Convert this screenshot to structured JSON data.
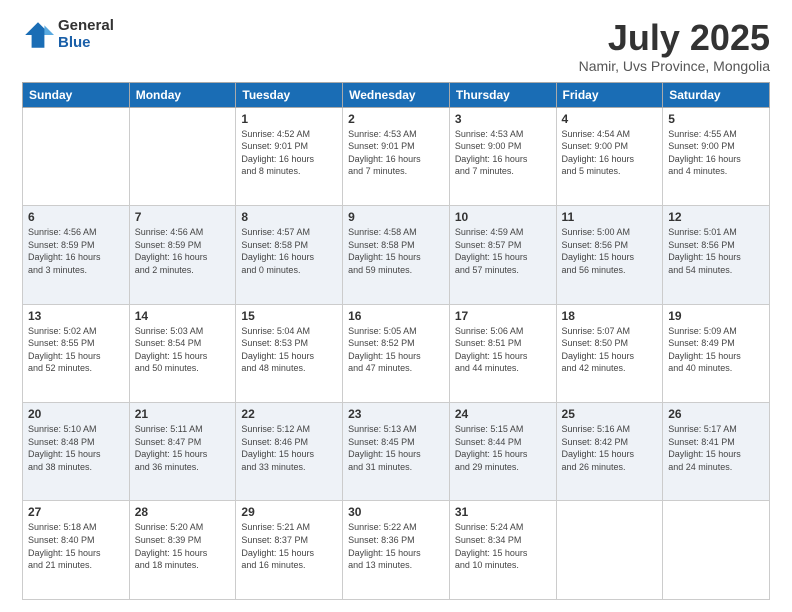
{
  "logo": {
    "general": "General",
    "blue": "Blue"
  },
  "title": "July 2025",
  "subtitle": "Namir, Uvs Province, Mongolia",
  "headers": [
    "Sunday",
    "Monday",
    "Tuesday",
    "Wednesday",
    "Thursday",
    "Friday",
    "Saturday"
  ],
  "weeks": [
    [
      {
        "day": "",
        "info": ""
      },
      {
        "day": "",
        "info": ""
      },
      {
        "day": "1",
        "info": "Sunrise: 4:52 AM\nSunset: 9:01 PM\nDaylight: 16 hours\nand 8 minutes."
      },
      {
        "day": "2",
        "info": "Sunrise: 4:53 AM\nSunset: 9:01 PM\nDaylight: 16 hours\nand 7 minutes."
      },
      {
        "day": "3",
        "info": "Sunrise: 4:53 AM\nSunset: 9:00 PM\nDaylight: 16 hours\nand 7 minutes."
      },
      {
        "day": "4",
        "info": "Sunrise: 4:54 AM\nSunset: 9:00 PM\nDaylight: 16 hours\nand 5 minutes."
      },
      {
        "day": "5",
        "info": "Sunrise: 4:55 AM\nSunset: 9:00 PM\nDaylight: 16 hours\nand 4 minutes."
      }
    ],
    [
      {
        "day": "6",
        "info": "Sunrise: 4:56 AM\nSunset: 8:59 PM\nDaylight: 16 hours\nand 3 minutes."
      },
      {
        "day": "7",
        "info": "Sunrise: 4:56 AM\nSunset: 8:59 PM\nDaylight: 16 hours\nand 2 minutes."
      },
      {
        "day": "8",
        "info": "Sunrise: 4:57 AM\nSunset: 8:58 PM\nDaylight: 16 hours\nand 0 minutes."
      },
      {
        "day": "9",
        "info": "Sunrise: 4:58 AM\nSunset: 8:58 PM\nDaylight: 15 hours\nand 59 minutes."
      },
      {
        "day": "10",
        "info": "Sunrise: 4:59 AM\nSunset: 8:57 PM\nDaylight: 15 hours\nand 57 minutes."
      },
      {
        "day": "11",
        "info": "Sunrise: 5:00 AM\nSunset: 8:56 PM\nDaylight: 15 hours\nand 56 minutes."
      },
      {
        "day": "12",
        "info": "Sunrise: 5:01 AM\nSunset: 8:56 PM\nDaylight: 15 hours\nand 54 minutes."
      }
    ],
    [
      {
        "day": "13",
        "info": "Sunrise: 5:02 AM\nSunset: 8:55 PM\nDaylight: 15 hours\nand 52 minutes."
      },
      {
        "day": "14",
        "info": "Sunrise: 5:03 AM\nSunset: 8:54 PM\nDaylight: 15 hours\nand 50 minutes."
      },
      {
        "day": "15",
        "info": "Sunrise: 5:04 AM\nSunset: 8:53 PM\nDaylight: 15 hours\nand 48 minutes."
      },
      {
        "day": "16",
        "info": "Sunrise: 5:05 AM\nSunset: 8:52 PM\nDaylight: 15 hours\nand 47 minutes."
      },
      {
        "day": "17",
        "info": "Sunrise: 5:06 AM\nSunset: 8:51 PM\nDaylight: 15 hours\nand 44 minutes."
      },
      {
        "day": "18",
        "info": "Sunrise: 5:07 AM\nSunset: 8:50 PM\nDaylight: 15 hours\nand 42 minutes."
      },
      {
        "day": "19",
        "info": "Sunrise: 5:09 AM\nSunset: 8:49 PM\nDaylight: 15 hours\nand 40 minutes."
      }
    ],
    [
      {
        "day": "20",
        "info": "Sunrise: 5:10 AM\nSunset: 8:48 PM\nDaylight: 15 hours\nand 38 minutes."
      },
      {
        "day": "21",
        "info": "Sunrise: 5:11 AM\nSunset: 8:47 PM\nDaylight: 15 hours\nand 36 minutes."
      },
      {
        "day": "22",
        "info": "Sunrise: 5:12 AM\nSunset: 8:46 PM\nDaylight: 15 hours\nand 33 minutes."
      },
      {
        "day": "23",
        "info": "Sunrise: 5:13 AM\nSunset: 8:45 PM\nDaylight: 15 hours\nand 31 minutes."
      },
      {
        "day": "24",
        "info": "Sunrise: 5:15 AM\nSunset: 8:44 PM\nDaylight: 15 hours\nand 29 minutes."
      },
      {
        "day": "25",
        "info": "Sunrise: 5:16 AM\nSunset: 8:42 PM\nDaylight: 15 hours\nand 26 minutes."
      },
      {
        "day": "26",
        "info": "Sunrise: 5:17 AM\nSunset: 8:41 PM\nDaylight: 15 hours\nand 24 minutes."
      }
    ],
    [
      {
        "day": "27",
        "info": "Sunrise: 5:18 AM\nSunset: 8:40 PM\nDaylight: 15 hours\nand 21 minutes."
      },
      {
        "day": "28",
        "info": "Sunrise: 5:20 AM\nSunset: 8:39 PM\nDaylight: 15 hours\nand 18 minutes."
      },
      {
        "day": "29",
        "info": "Sunrise: 5:21 AM\nSunset: 8:37 PM\nDaylight: 15 hours\nand 16 minutes."
      },
      {
        "day": "30",
        "info": "Sunrise: 5:22 AM\nSunset: 8:36 PM\nDaylight: 15 hours\nand 13 minutes."
      },
      {
        "day": "31",
        "info": "Sunrise: 5:24 AM\nSunset: 8:34 PM\nDaylight: 15 hours\nand 10 minutes."
      },
      {
        "day": "",
        "info": ""
      },
      {
        "day": "",
        "info": ""
      }
    ]
  ]
}
